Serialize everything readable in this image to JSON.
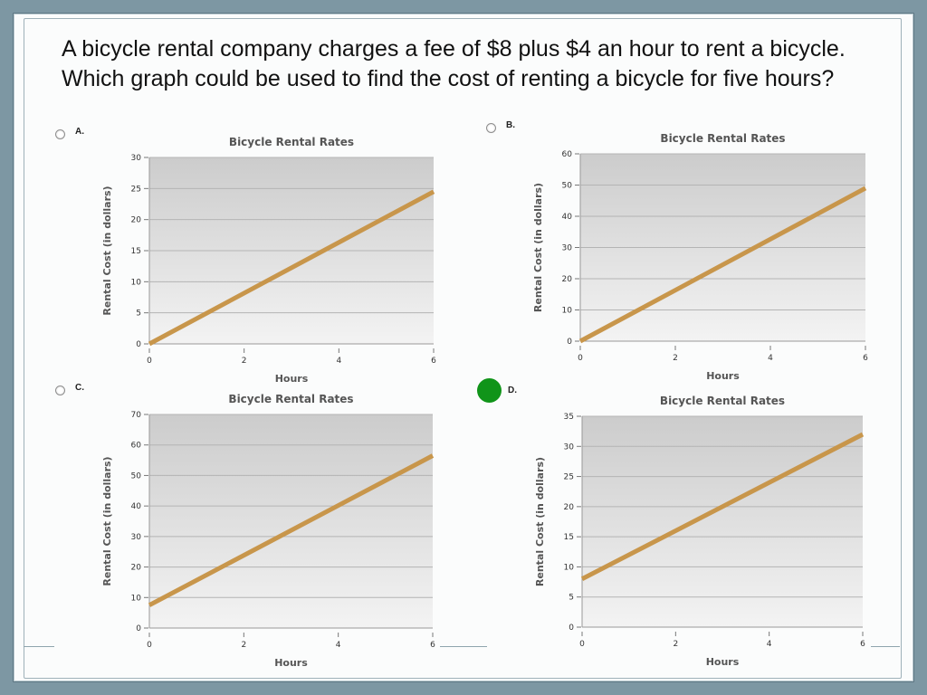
{
  "question": "A bicycle rental company charges a fee of $8 plus $4 an hour to rent a bicycle. Which graph could be used to find the cost of renting a bicycle for five hours?",
  "selected_option": "D.",
  "colors": {
    "line": "#c8964b",
    "selected": "#109419"
  },
  "chart_data": [
    {
      "option": "A.",
      "type": "line",
      "title": "Bicycle Rental Rates",
      "xlabel": "Hours",
      "ylabel": "Rental Cost (in dollars)",
      "xlim": [
        0,
        6
      ],
      "ylim": [
        0,
        30
      ],
      "xticks": [
        0,
        2,
        4,
        6
      ],
      "yticks": [
        0,
        5,
        10,
        15,
        20,
        25,
        30
      ],
      "series": [
        {
          "x": [
            0,
            6
          ],
          "y": [
            0,
            24.5
          ]
        }
      ]
    },
    {
      "option": "B.",
      "type": "line",
      "title": "Bicycle Rental Rates",
      "xlabel": "Hours",
      "ylabel": "Rental Cost (in dollars)",
      "xlim": [
        0,
        6
      ],
      "ylim": [
        0,
        60
      ],
      "xticks": [
        0,
        2,
        4,
        6
      ],
      "yticks": [
        0,
        10,
        20,
        30,
        40,
        50,
        60
      ],
      "series": [
        {
          "x": [
            0,
            6
          ],
          "y": [
            0,
            49
          ]
        }
      ]
    },
    {
      "option": "C.",
      "type": "line",
      "title": "Bicycle Rental Rates",
      "xlabel": "Hours",
      "ylabel": "Rental Cost (in dollars)",
      "xlim": [
        0,
        6
      ],
      "ylim": [
        0,
        70
      ],
      "xticks": [
        0,
        2,
        4,
        6
      ],
      "yticks": [
        0,
        10,
        20,
        30,
        40,
        50,
        60,
        70
      ],
      "series": [
        {
          "x": [
            0,
            6
          ],
          "y": [
            7.5,
            56.5
          ]
        }
      ]
    },
    {
      "option": "D.",
      "type": "line",
      "title": "Bicycle Rental Rates",
      "xlabel": "Hours",
      "ylabel": "Rental Cost (in dollars)",
      "xlim": [
        0,
        6
      ],
      "ylim": [
        0,
        35
      ],
      "xticks": [
        0,
        2,
        4,
        6
      ],
      "yticks": [
        0,
        5,
        10,
        15,
        20,
        25,
        30,
        35
      ],
      "series": [
        {
          "x": [
            0,
            6
          ],
          "y": [
            8,
            32
          ]
        }
      ]
    }
  ]
}
